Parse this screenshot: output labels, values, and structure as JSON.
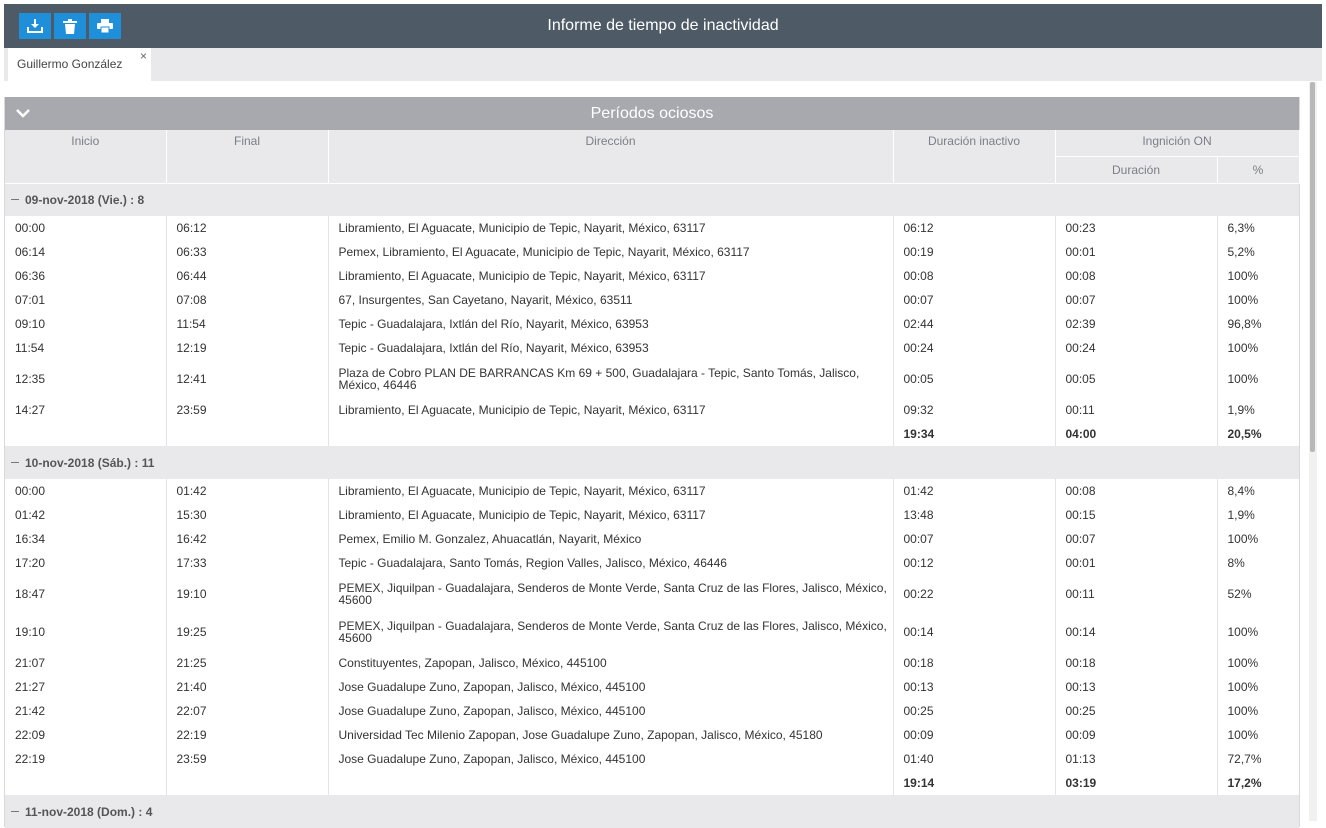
{
  "window": {
    "title": "Informe de tiempo de inactividad"
  },
  "toolbar": {
    "buttons": [
      {
        "name": "download-button",
        "icon": "download-icon"
      },
      {
        "name": "delete-button",
        "icon": "trash-icon"
      },
      {
        "name": "print-button",
        "icon": "printer-icon"
      }
    ]
  },
  "tabs": [
    {
      "label": "Guillermo González",
      "close": "×"
    }
  ],
  "panel": {
    "title": "Períodos ociosos",
    "columns": {
      "inicio": "Inicio",
      "final": "Final",
      "direccion": "Dirección",
      "duracion_inactivo": "Duración inactivo",
      "ignicion_on": "Ingnición ON",
      "duracion": "Duración",
      "pct": "%"
    },
    "groups": [
      {
        "label": "09-nov-2018 (Vie.) : 8",
        "rows": [
          [
            "00:00",
            "06:12",
            "Libramiento, El Aguacate, Municipio de Tepic, Nayarit, México, 63117",
            "06:12",
            "00:23",
            "6,3%"
          ],
          [
            "06:14",
            "06:33",
            "Pemex, Libramiento, El Aguacate, Municipio de Tepic, Nayarit, México, 63117",
            "00:19",
            "00:01",
            "5,2%"
          ],
          [
            "06:36",
            "06:44",
            "Libramiento, El Aguacate, Municipio de Tepic, Nayarit, México, 63117",
            "00:08",
            "00:08",
            "100%"
          ],
          [
            "07:01",
            "07:08",
            "67, Insurgentes, San Cayetano, Nayarit, México, 63511",
            "00:07",
            "00:07",
            "100%"
          ],
          [
            "09:10",
            "11:54",
            "Tepic - Guadalajara, Ixtlán del Río, Nayarit, México, 63953",
            "02:44",
            "02:39",
            "96,8%"
          ],
          [
            "11:54",
            "12:19",
            "Tepic - Guadalajara, Ixtlán del Río, Nayarit, México, 63953",
            "00:24",
            "00:24",
            "100%"
          ],
          [
            "12:35",
            "12:41",
            "Plaza de Cobro PLAN DE BARRANCAS Km 69 + 500, Guadalajara - Tepic, Santo Tomás, Jalisco, México, 46446",
            "00:05",
            "00:05",
            "100%"
          ],
          [
            "14:27",
            "23:59",
            "Libramiento, El Aguacate, Municipio de Tepic, Nayarit, México, 63117",
            "09:32",
            "00:11",
            "1,9%"
          ]
        ],
        "total": [
          "19:34",
          "04:00",
          "20,5%"
        ]
      },
      {
        "label": "10-nov-2018 (Sáb.) : 11",
        "rows": [
          [
            "00:00",
            "01:42",
            "Libramiento, El Aguacate, Municipio de Tepic, Nayarit, México, 63117",
            "01:42",
            "00:08",
            "8,4%"
          ],
          [
            "01:42",
            "15:30",
            "Libramiento, El Aguacate, Municipio de Tepic, Nayarit, México, 63117",
            "13:48",
            "00:15",
            "1,9%"
          ],
          [
            "16:34",
            "16:42",
            "Pemex, Emilio M. Gonzalez, Ahuacatlán, Nayarit, México",
            "00:07",
            "00:07",
            "100%"
          ],
          [
            "17:20",
            "17:33",
            "Tepic - Guadalajara, Santo Tomás, Region Valles, Jalisco, México, 46446",
            "00:12",
            "00:01",
            "8%"
          ],
          [
            "18:47",
            "19:10",
            "PEMEX, Jiquilpan - Guadalajara, Senderos de Monte Verde, Santa Cruz de las Flores, Jalisco, México, 45600",
            "00:22",
            "00:11",
            "52%"
          ],
          [
            "19:10",
            "19:25",
            "PEMEX, Jiquilpan - Guadalajara, Senderos de Monte Verde, Santa Cruz de las Flores, Jalisco, México, 45600",
            "00:14",
            "00:14",
            "100%"
          ],
          [
            "21:07",
            "21:25",
            "Constituyentes, Zapopan, Jalisco, México, 445100",
            "00:18",
            "00:18",
            "100%"
          ],
          [
            "21:27",
            "21:40",
            "Jose Guadalupe Zuno, Zapopan, Jalisco, México, 445100",
            "00:13",
            "00:13",
            "100%"
          ],
          [
            "21:42",
            "22:07",
            "Jose Guadalupe Zuno, Zapopan, Jalisco, México, 445100",
            "00:25",
            "00:25",
            "100%"
          ],
          [
            "22:09",
            "22:19",
            "Universidad Tec Milenio Zapopan, Jose Guadalupe Zuno, Zapopan, Jalisco, México, 45180",
            "00:09",
            "00:09",
            "100%"
          ],
          [
            "22:19",
            "23:59",
            "Jose Guadalupe Zuno, Zapopan, Jalisco, México, 445100",
            "01:40",
            "01:13",
            "72,7%"
          ]
        ],
        "total": [
          "19:14",
          "03:19",
          "17,2%"
        ]
      },
      {
        "label": "11-nov-2018 (Dom.) : 4",
        "rows": [],
        "total": null
      }
    ]
  },
  "colors": {
    "topbar": "#4e5a66",
    "button": "#1e8fd8",
    "panel_header": "#a7a9ae",
    "table_header": "#e9e9ec"
  }
}
